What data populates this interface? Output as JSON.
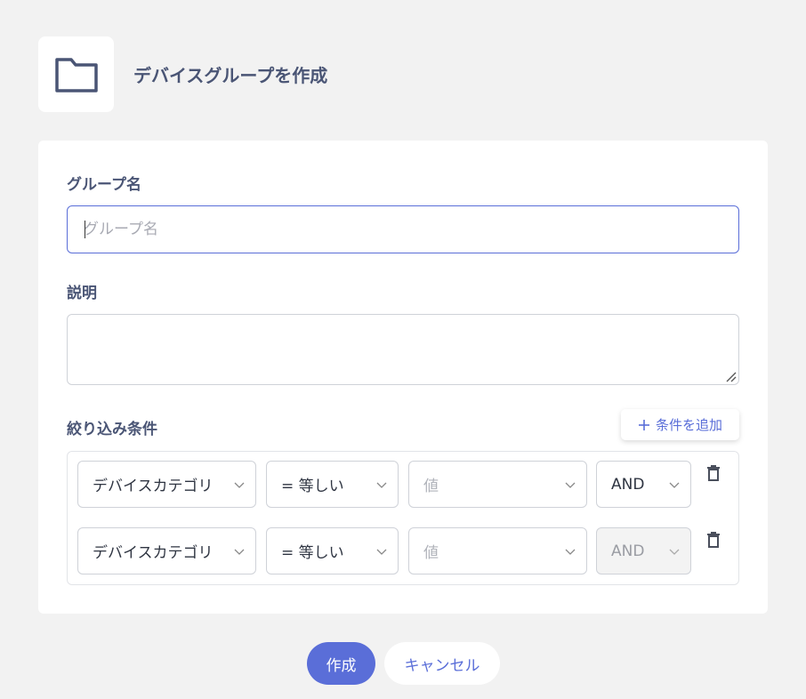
{
  "header": {
    "icon": "folder-icon",
    "title": "デバイスグループを作成"
  },
  "form": {
    "name_label": "グループ名",
    "name_placeholder": "グループ名",
    "name_value": "",
    "desc_label": "説明",
    "desc_value": "",
    "filter_label": "絞り込み条件",
    "add_condition_label": "条件を追加",
    "conditions": [
      {
        "field": "デバイスカテゴリ",
        "operator": "= 等しい",
        "value_placeholder": "値",
        "logic": "AND",
        "logic_disabled": false
      },
      {
        "field": "デバイスカテゴリ",
        "operator": "= 等しい",
        "value_placeholder": "値",
        "logic": "AND",
        "logic_disabled": true
      }
    ]
  },
  "actions": {
    "create_label": "作成",
    "cancel_label": "キャンセル"
  },
  "colors": {
    "accent": "#5a6ed8",
    "title": "#4a5575",
    "background": "#f2f2f2"
  }
}
